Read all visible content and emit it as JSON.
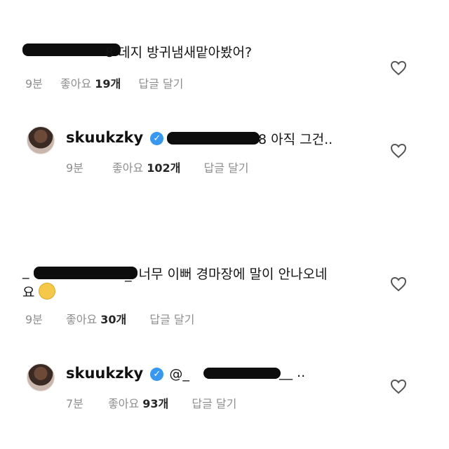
{
  "comments": [
    {
      "text": "8 데지 방귀냄새맡아봤어?",
      "time": "9분",
      "likes_label": "좋아요",
      "likes_count": "19개",
      "reply_label": "답글 달기"
    },
    {
      "username": "skuukzky",
      "mention_tail": "8",
      "text": "아직 그건..",
      "time": "9분",
      "likes_label": "좋아요",
      "likes_count": "102개",
      "reply_label": "답글 달기"
    },
    {
      "prefix": "_",
      "mention_tail": "_",
      "text_line1": "너무 이뻐 경마장에 말이 안나오네",
      "text_line2": "요",
      "time": "9분",
      "likes_label": "좋아요",
      "likes_count": "30개",
      "reply_label": "답글 달기"
    },
    {
      "username": "skuukzky",
      "mention_prefix": "@_",
      "mention_tail": "__ ..",
      "time": "7분",
      "likes_label": "좋아요",
      "likes_count": "93개",
      "reply_label": "답글 달기"
    }
  ],
  "icons": {
    "like": "heart-outline-icon",
    "verified": "verified-badge-icon",
    "emoji": "shushing-face-emoji"
  }
}
